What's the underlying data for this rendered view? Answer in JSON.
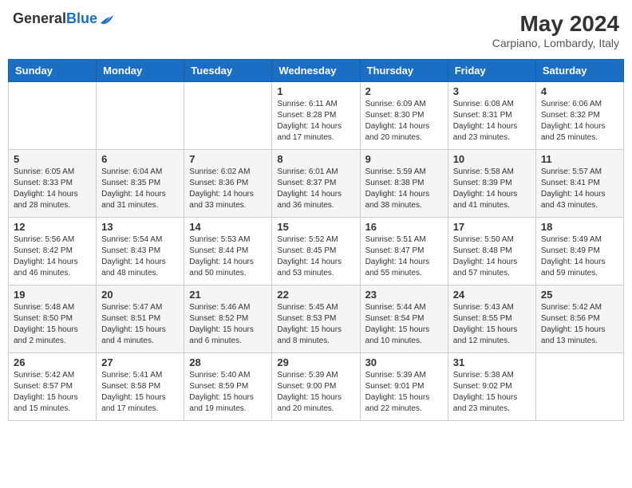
{
  "header": {
    "logo_general": "General",
    "logo_blue": "Blue",
    "month_year": "May 2024",
    "location": "Carpiano, Lombardy, Italy"
  },
  "days_of_week": [
    "Sunday",
    "Monday",
    "Tuesday",
    "Wednesday",
    "Thursday",
    "Friday",
    "Saturday"
  ],
  "weeks": [
    [
      {
        "day": "",
        "info": ""
      },
      {
        "day": "",
        "info": ""
      },
      {
        "day": "",
        "info": ""
      },
      {
        "day": "1",
        "info": "Sunrise: 6:11 AM\nSunset: 8:28 PM\nDaylight: 14 hours\nand 17 minutes."
      },
      {
        "day": "2",
        "info": "Sunrise: 6:09 AM\nSunset: 8:30 PM\nDaylight: 14 hours\nand 20 minutes."
      },
      {
        "day": "3",
        "info": "Sunrise: 6:08 AM\nSunset: 8:31 PM\nDaylight: 14 hours\nand 23 minutes."
      },
      {
        "day": "4",
        "info": "Sunrise: 6:06 AM\nSunset: 8:32 PM\nDaylight: 14 hours\nand 25 minutes."
      }
    ],
    [
      {
        "day": "5",
        "info": "Sunrise: 6:05 AM\nSunset: 8:33 PM\nDaylight: 14 hours\nand 28 minutes."
      },
      {
        "day": "6",
        "info": "Sunrise: 6:04 AM\nSunset: 8:35 PM\nDaylight: 14 hours\nand 31 minutes."
      },
      {
        "day": "7",
        "info": "Sunrise: 6:02 AM\nSunset: 8:36 PM\nDaylight: 14 hours\nand 33 minutes."
      },
      {
        "day": "8",
        "info": "Sunrise: 6:01 AM\nSunset: 8:37 PM\nDaylight: 14 hours\nand 36 minutes."
      },
      {
        "day": "9",
        "info": "Sunrise: 5:59 AM\nSunset: 8:38 PM\nDaylight: 14 hours\nand 38 minutes."
      },
      {
        "day": "10",
        "info": "Sunrise: 5:58 AM\nSunset: 8:39 PM\nDaylight: 14 hours\nand 41 minutes."
      },
      {
        "day": "11",
        "info": "Sunrise: 5:57 AM\nSunset: 8:41 PM\nDaylight: 14 hours\nand 43 minutes."
      }
    ],
    [
      {
        "day": "12",
        "info": "Sunrise: 5:56 AM\nSunset: 8:42 PM\nDaylight: 14 hours\nand 46 minutes."
      },
      {
        "day": "13",
        "info": "Sunrise: 5:54 AM\nSunset: 8:43 PM\nDaylight: 14 hours\nand 48 minutes."
      },
      {
        "day": "14",
        "info": "Sunrise: 5:53 AM\nSunset: 8:44 PM\nDaylight: 14 hours\nand 50 minutes."
      },
      {
        "day": "15",
        "info": "Sunrise: 5:52 AM\nSunset: 8:45 PM\nDaylight: 14 hours\nand 53 minutes."
      },
      {
        "day": "16",
        "info": "Sunrise: 5:51 AM\nSunset: 8:47 PM\nDaylight: 14 hours\nand 55 minutes."
      },
      {
        "day": "17",
        "info": "Sunrise: 5:50 AM\nSunset: 8:48 PM\nDaylight: 14 hours\nand 57 minutes."
      },
      {
        "day": "18",
        "info": "Sunrise: 5:49 AM\nSunset: 8:49 PM\nDaylight: 14 hours\nand 59 minutes."
      }
    ],
    [
      {
        "day": "19",
        "info": "Sunrise: 5:48 AM\nSunset: 8:50 PM\nDaylight: 15 hours\nand 2 minutes."
      },
      {
        "day": "20",
        "info": "Sunrise: 5:47 AM\nSunset: 8:51 PM\nDaylight: 15 hours\nand 4 minutes."
      },
      {
        "day": "21",
        "info": "Sunrise: 5:46 AM\nSunset: 8:52 PM\nDaylight: 15 hours\nand 6 minutes."
      },
      {
        "day": "22",
        "info": "Sunrise: 5:45 AM\nSunset: 8:53 PM\nDaylight: 15 hours\nand 8 minutes."
      },
      {
        "day": "23",
        "info": "Sunrise: 5:44 AM\nSunset: 8:54 PM\nDaylight: 15 hours\nand 10 minutes."
      },
      {
        "day": "24",
        "info": "Sunrise: 5:43 AM\nSunset: 8:55 PM\nDaylight: 15 hours\nand 12 minutes."
      },
      {
        "day": "25",
        "info": "Sunrise: 5:42 AM\nSunset: 8:56 PM\nDaylight: 15 hours\nand 13 minutes."
      }
    ],
    [
      {
        "day": "26",
        "info": "Sunrise: 5:42 AM\nSunset: 8:57 PM\nDaylight: 15 hours\nand 15 minutes."
      },
      {
        "day": "27",
        "info": "Sunrise: 5:41 AM\nSunset: 8:58 PM\nDaylight: 15 hours\nand 17 minutes."
      },
      {
        "day": "28",
        "info": "Sunrise: 5:40 AM\nSunset: 8:59 PM\nDaylight: 15 hours\nand 19 minutes."
      },
      {
        "day": "29",
        "info": "Sunrise: 5:39 AM\nSunset: 9:00 PM\nDaylight: 15 hours\nand 20 minutes."
      },
      {
        "day": "30",
        "info": "Sunrise: 5:39 AM\nSunset: 9:01 PM\nDaylight: 15 hours\nand 22 minutes."
      },
      {
        "day": "31",
        "info": "Sunrise: 5:38 AM\nSunset: 9:02 PM\nDaylight: 15 hours\nand 23 minutes."
      },
      {
        "day": "",
        "info": ""
      }
    ]
  ]
}
